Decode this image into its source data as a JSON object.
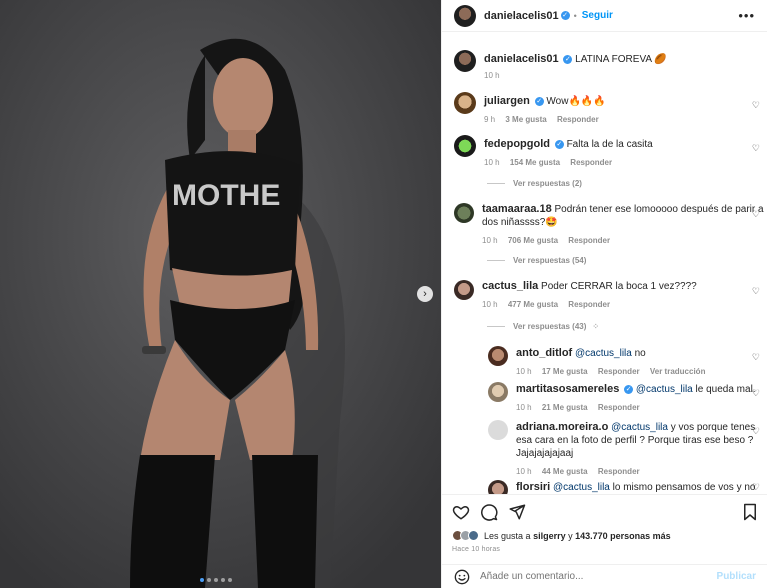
{
  "post": {
    "author": "danielacelis01",
    "follow_label": "Seguir",
    "more_icon": "more-horizontal-icon",
    "caption": "LATINA FOREVA 🏉",
    "caption_time": "10 h",
    "shirt_text": "MOTHE",
    "carousel_dots": 5
  },
  "comments": [
    {
      "user": "juliargen",
      "verified": true,
      "text": "Wow🔥🔥🔥",
      "time": "9 h",
      "likes": "3 Me gusta",
      "reply": "Responder"
    },
    {
      "user": "fedepopgold",
      "verified": true,
      "text": "Falta la de la casita",
      "time": "10 h",
      "likes": "154 Me gusta",
      "reply": "Responder",
      "view_replies": "Ver respuestas (2)"
    },
    {
      "user": "taamaaraa.18",
      "verified": false,
      "text": "Podrán tener ese lomooooo después de parir a dos niñassss?🤩",
      "time": "10 h",
      "likes": "706 Me gusta",
      "reply": "Responder",
      "view_replies": "Ver respuestas (54)"
    },
    {
      "user": "cactus_lila",
      "verified": false,
      "text": "Poder CERRAR la boca 1 vez????",
      "time": "10 h",
      "likes": "477 Me gusta",
      "reply": "Responder",
      "view_replies": "Ver respuestas (43)"
    }
  ],
  "replies": [
    {
      "user": "anto_ditlof",
      "mention": "@cactus_lila",
      "text": "no",
      "time": "10 h",
      "likes": "17 Me gusta",
      "reply": "Responder",
      "translate": "Ver traducción"
    },
    {
      "user": "martitasosamereles",
      "verified": true,
      "mention": "@cactus_lila",
      "text": "le queda mal.",
      "time": "10 h",
      "likes": "21 Me gusta",
      "reply": "Responder"
    },
    {
      "user": "adriana.moreira.o",
      "mention": "@cactus_lila",
      "text": "y vos porque tenes esa cara en la foto de perfil ? Porque tiras ese beso ? Jajajajajajaaj",
      "time": "10 h",
      "likes": "44 Me gusta",
      "reply": "Responder"
    },
    {
      "user": "florsiri",
      "mention": "@cactus_lila",
      "text": "lo mismo pensamos de vos y no"
    }
  ],
  "likes_summary": {
    "prefix": "Les gusta a",
    "user": "silgerry",
    "middle": "y",
    "count": "143.770 personas más"
  },
  "time_ago": "Hace 10 horas",
  "add_comment": {
    "placeholder": "Añade un comentario...",
    "publish": "Publicar"
  },
  "colors": {
    "link": "#0095f6",
    "verified": "#3897f0",
    "muted": "#8e8e8e",
    "photo_bg": "#4a4a4c"
  }
}
